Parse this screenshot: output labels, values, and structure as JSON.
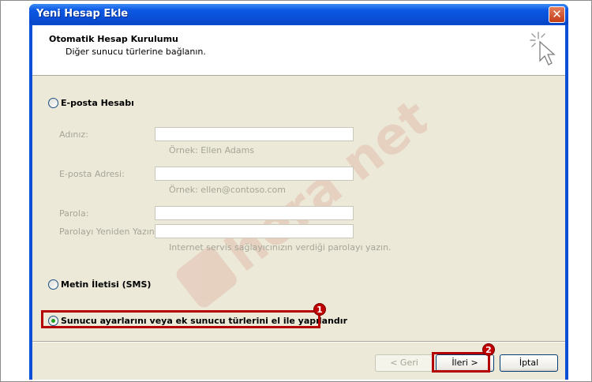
{
  "window": {
    "title": "Yeni Hesap Ekle",
    "close_symbol": "✕",
    "titlebar_color": "#0a4fd6"
  },
  "header": {
    "title": "Otomatik Hesap Kurulumu",
    "subtitle": "Diğer sunucu türlerine bağlanın.",
    "icon": "wizard-cursor-icon"
  },
  "options": {
    "email": {
      "label": "E-posta Hesabı",
      "selected": false
    },
    "sms": {
      "label": "Metin İletisi (SMS)",
      "selected": false
    },
    "manual": {
      "label": "Sunucu ayarlarını veya ek sunucu türlerini el ile yapılandır",
      "selected": true
    }
  },
  "form": {
    "name": {
      "label": "Adınız:",
      "value": "",
      "hint": "Örnek: Ellen Adams"
    },
    "email": {
      "label": "E-posta Adresi:",
      "value": "",
      "hint": "Örnek: ellen@contoso.com"
    },
    "password": {
      "label": "Parola:",
      "value": ""
    },
    "password_confirm": {
      "label": "Parolayı Yeniden Yazın:",
      "value": "",
      "hint": "Internet servis sağlayıcınızın verdiği parolayı yazın."
    }
  },
  "buttons": {
    "back": "< Geri",
    "next": "İleri >",
    "cancel": "İptal"
  },
  "annotations": {
    "badge1": "1",
    "badge2": "2",
    "color": "#b40000"
  },
  "watermark": {
    "text": "hera net"
  }
}
